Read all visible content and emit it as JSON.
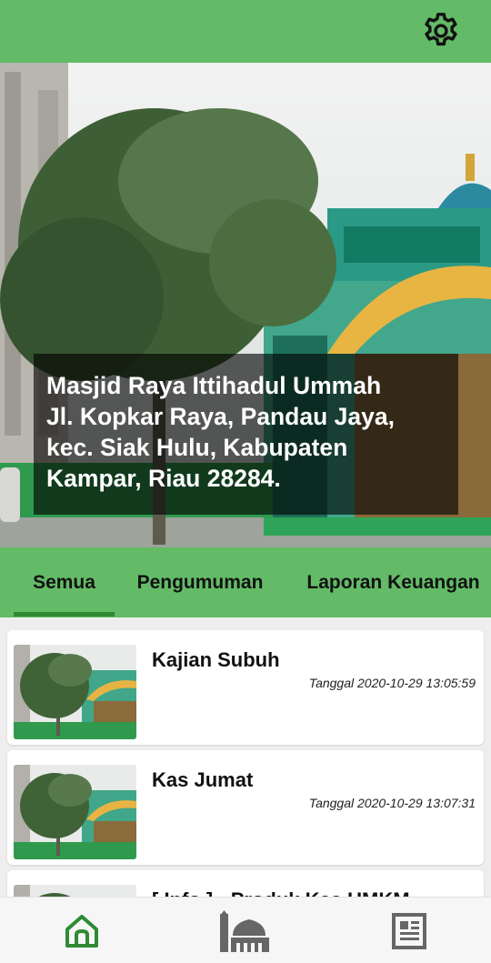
{
  "app_bar": {
    "settings_icon": "gear-icon"
  },
  "hero": {
    "caption_lines": [
      "Masjid Raya Ittihadul Ummah",
      "Jl. Kopkar Raya, Pandau Jaya,",
      "kec. Siak Hulu, Kabupaten",
      "Kampar, Riau 28284."
    ]
  },
  "tabs": [
    {
      "label": "Semua",
      "selected": true
    },
    {
      "label": "Pengumuman",
      "selected": false
    },
    {
      "label": "Laporan Keuangan",
      "selected": false
    }
  ],
  "posts": [
    {
      "title": "Kajian Subuh",
      "date": "Tanggal 2020-10-29 13:05:59"
    },
    {
      "title": "Kas Jumat",
      "date": "Tanggal 2020-10-29 13:07:31"
    },
    {
      "title": "[ Info ] - Produk Kas UMKM",
      "date": ""
    }
  ],
  "bottom_nav": [
    {
      "icon": "home-icon",
      "active": true
    },
    {
      "icon": "mosque-icon",
      "active": false
    },
    {
      "icon": "newspaper-icon",
      "active": false
    }
  ],
  "colors": {
    "primary": "#63bb67",
    "primary_dark": "#2e8b33",
    "nav_active": "#2e8b33",
    "nav_inactive": "#666666"
  }
}
